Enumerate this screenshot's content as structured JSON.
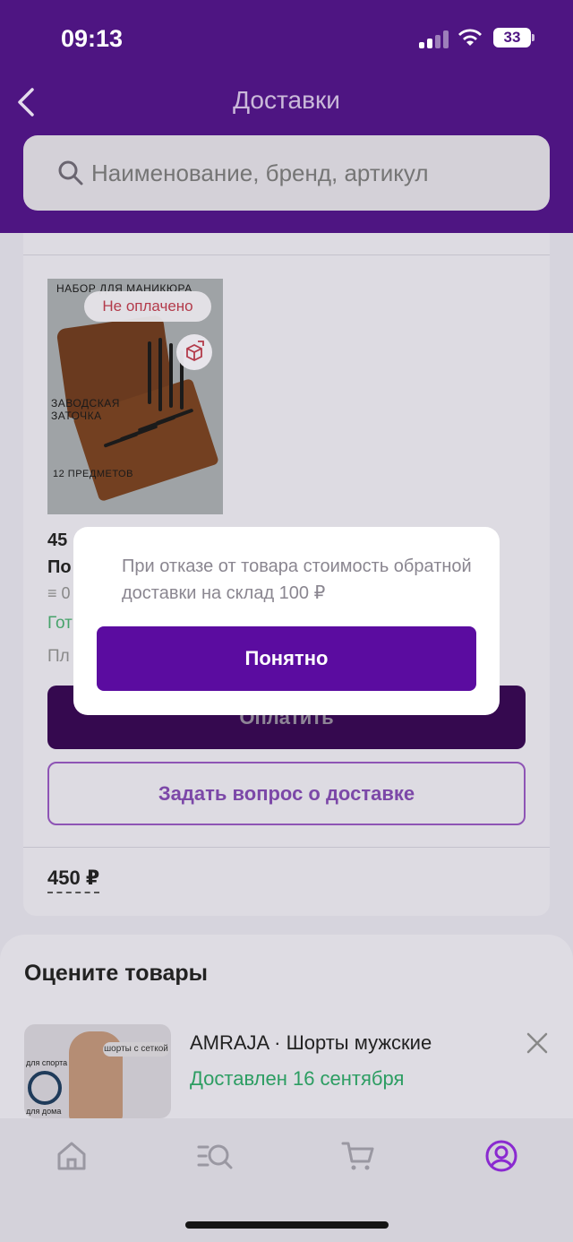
{
  "status_bar": {
    "time": "09:13",
    "battery": "33"
  },
  "header": {
    "title": "Доставки"
  },
  "search": {
    "placeholder": "Наименование, бренд, артикул"
  },
  "delivery_item": {
    "image_caption_top": "НАБОР ДЛЯ МАНИКЮРА",
    "image_caption_middle": "ЗАВОДСКАЯ ЗАТОЧКА",
    "image_caption_bottom": "12 ПРЕДМЕТОВ",
    "unpaid_badge": "Не оплачено",
    "price_partial": "45",
    "name_partial": "По",
    "meta_partial": "0",
    "status_partial": "Гот",
    "payment_partial": "Пл",
    "pay_button": "Оплатить",
    "ask_button": "Задать вопрос о доставке",
    "total": "450 ₽"
  },
  "modal": {
    "text": "При отказе от товара стоимость обратной доставки на склад 100 ₽",
    "button": "Понятно"
  },
  "rate_section": {
    "title": "Оцените товары",
    "thumb_label": "шорты с сеткой",
    "thumb_label_sport": "для спорта",
    "thumb_label_home": "для дома",
    "item_name": "AMRAJA · Шорты мужские",
    "item_status": "Доставлен 16 сентября"
  },
  "tab_bar": {
    "tabs": [
      "home-icon",
      "catalog-search-icon",
      "cart-icon",
      "profile-icon"
    ],
    "active_color": "#8a2ad0"
  },
  "colors": {
    "brand": "#4e1582",
    "primary_button": "#5b0ca0",
    "success": "#2c9d62",
    "error": "#b33a4a"
  }
}
